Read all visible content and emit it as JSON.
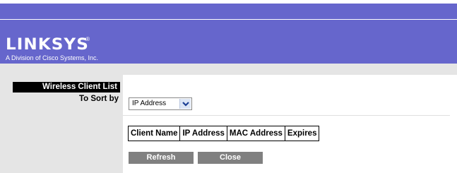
{
  "brand": {
    "logo_text": "LINKSYS",
    "logo_registered": "®",
    "tagline": "A Division of Cisco Systems, Inc."
  },
  "section": {
    "title": "Wireless Client List"
  },
  "sort": {
    "label": "To Sort by",
    "selected": "IP Address"
  },
  "table": {
    "headers": [
      "Client Name",
      "IP Address",
      "MAC Address",
      "Expires"
    ],
    "rows": []
  },
  "buttons": {
    "refresh": "Refresh",
    "close": "Close"
  },
  "colors": {
    "header_band": "#6666cc",
    "side_gray": "#e5e5e5",
    "button_gray": "#808080"
  },
  "icons": {
    "dropdown": "chevron-down-icon"
  }
}
